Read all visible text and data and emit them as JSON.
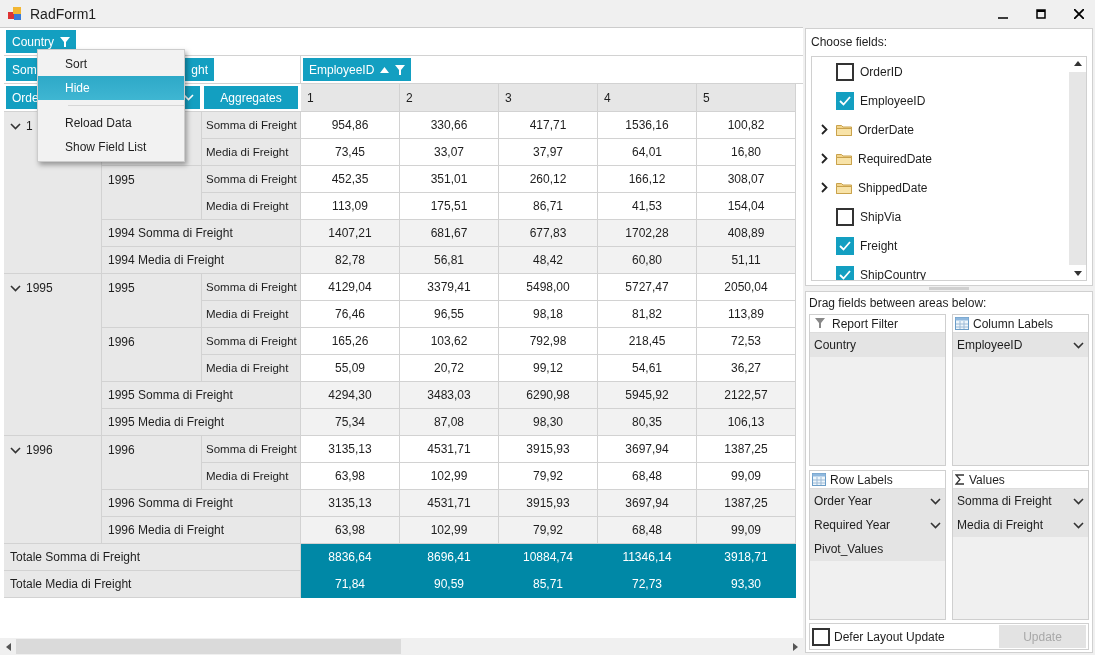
{
  "window": {
    "title": "RadForm1"
  },
  "pivot": {
    "filter_fields": [
      {
        "label": "Country"
      }
    ],
    "data_fields": [
      {
        "label": "Som"
      },
      {
        "label": "ght"
      }
    ],
    "column_fields": [
      {
        "label": "EmployeeID",
        "sorted": true
      }
    ],
    "row_fields": [
      {
        "label": "Orde"
      },
      {
        "has_menu": true
      }
    ],
    "aggregates_button": "Aggregates",
    "column_headers": [
      "1",
      "2",
      "3",
      "4",
      "5"
    ],
    "groups": [
      {
        "label": "1",
        "expanded": true,
        "subgroups": [
          {
            "measures": [
              {
                "label": "Somma di Freight",
                "values": [
                  "954,86",
                  "330,66",
                  "417,71",
                  "1536,16",
                  "100,82"
                ]
              },
              {
                "label": "Media di Freight",
                "values": [
                  "73,45",
                  "33,07",
                  "37,97",
                  "64,01",
                  "16,80"
                ]
              }
            ]
          },
          {
            "label": "1995",
            "measures": [
              {
                "label": "Somma di Freight",
                "values": [
                  "452,35",
                  "351,01",
                  "260,12",
                  "166,12",
                  "308,07"
                ]
              },
              {
                "label": "Media di Freight",
                "values": [
                  "113,09",
                  "175,51",
                  "86,71",
                  "41,53",
                  "154,04"
                ]
              }
            ]
          }
        ],
        "totals": [
          {
            "label": "1994 Somma di Freight",
            "values": [
              "1407,21",
              "681,67",
              "677,83",
              "1702,28",
              "408,89"
            ]
          },
          {
            "label": "1994 Media di Freight",
            "values": [
              "82,78",
              "56,81",
              "48,42",
              "60,80",
              "51,11"
            ]
          }
        ]
      },
      {
        "label": "1995",
        "expanded": true,
        "subgroups": [
          {
            "label": "1995",
            "measures": [
              {
                "label": "Somma di Freight",
                "values": [
                  "4129,04",
                  "3379,41",
                  "5498,00",
                  "5727,47",
                  "2050,04"
                ]
              },
              {
                "label": "Media di Freight",
                "values": [
                  "76,46",
                  "96,55",
                  "98,18",
                  "81,82",
                  "113,89"
                ]
              }
            ]
          },
          {
            "label": "1996",
            "measures": [
              {
                "label": "Somma di Freight",
                "values": [
                  "165,26",
                  "103,62",
                  "792,98",
                  "218,45",
                  "72,53"
                ]
              },
              {
                "label": "Media di Freight",
                "values": [
                  "55,09",
                  "20,72",
                  "99,12",
                  "54,61",
                  "36,27"
                ]
              }
            ]
          }
        ],
        "totals": [
          {
            "label": "1995 Somma di Freight",
            "values": [
              "4294,30",
              "3483,03",
              "6290,98",
              "5945,92",
              "2122,57"
            ]
          },
          {
            "label": "1995 Media di Freight",
            "values": [
              "75,34",
              "87,08",
              "98,30",
              "80,35",
              "106,13"
            ]
          }
        ]
      },
      {
        "label": "1996",
        "expanded": true,
        "subgroups": [
          {
            "label": "1996",
            "measures": [
              {
                "label": "Somma di Freight",
                "values": [
                  "3135,13",
                  "4531,71",
                  "3915,93",
                  "3697,94",
                  "1387,25"
                ]
              },
              {
                "label": "Media di Freight",
                "values": [
                  "63,98",
                  "102,99",
                  "79,92",
                  "68,48",
                  "99,09"
                ]
              }
            ]
          }
        ],
        "totals": [
          {
            "label": "1996 Somma di Freight",
            "values": [
              "3135,13",
              "4531,71",
              "3915,93",
              "3697,94",
              "1387,25"
            ]
          },
          {
            "label": "1996 Media di Freight",
            "values": [
              "63,98",
              "102,99",
              "79,92",
              "68,48",
              "99,09"
            ]
          }
        ]
      }
    ],
    "grand_totals": [
      {
        "label": "Totale Somma di Freight",
        "values": [
          "8836,64",
          "8696,41",
          "10884,74",
          "11346,14",
          "3918,71"
        ]
      },
      {
        "label": "Totale Media di Freight",
        "values": [
          "71,84",
          "90,59",
          "85,71",
          "72,73",
          "93,30"
        ]
      }
    ]
  },
  "context_menu": {
    "items": [
      {
        "kind": "item",
        "label": "Sort",
        "selected": false
      },
      {
        "kind": "item",
        "label": "Hide",
        "selected": true
      },
      {
        "kind": "separator"
      },
      {
        "kind": "item",
        "label": "Reload Data",
        "selected": false
      },
      {
        "kind": "item",
        "label": "Show Field List",
        "selected": false
      }
    ]
  },
  "field_chooser": {
    "title": "Choose fields:",
    "fields": [
      {
        "kind": "field",
        "label": "OrderID",
        "checked": false
      },
      {
        "kind": "field",
        "label": "EmployeeID",
        "checked": true
      },
      {
        "kind": "folder",
        "label": "OrderDate",
        "expanded": false
      },
      {
        "kind": "folder",
        "label": "RequiredDate",
        "expanded": false
      },
      {
        "kind": "folder",
        "label": "ShippedDate",
        "expanded": false
      },
      {
        "kind": "field",
        "label": "ShipVia",
        "checked": false
      },
      {
        "kind": "field",
        "label": "Freight",
        "checked": true
      },
      {
        "kind": "field",
        "label": "ShipCountry",
        "checked": true
      }
    ]
  },
  "areas": {
    "title": "Drag fields between areas below:",
    "boxes": [
      {
        "kind": "filter",
        "title": "Report Filter",
        "items": [
          {
            "label": "Country",
            "has_menu": false
          }
        ]
      },
      {
        "kind": "table",
        "title": "Column Labels",
        "items": [
          {
            "label": "EmployeeID",
            "has_menu": true
          }
        ]
      },
      {
        "kind": "table",
        "title": "Row Labels",
        "items": [
          {
            "label": "Order Year",
            "has_menu": true
          },
          {
            "label": "Required Year",
            "has_menu": true
          },
          {
            "label": "Pivot_Values",
            "has_menu": false
          }
        ]
      },
      {
        "kind": "sum",
        "title": "Values",
        "items": [
          {
            "label": "Somma di Freight",
            "has_menu": true
          },
          {
            "label": "Media di Freight",
            "has_menu": true
          }
        ]
      }
    ]
  },
  "defer_update": {
    "label": "Defer Layout Update",
    "checked": false
  },
  "update_button": {
    "label": "Update",
    "disabled": true
  }
}
